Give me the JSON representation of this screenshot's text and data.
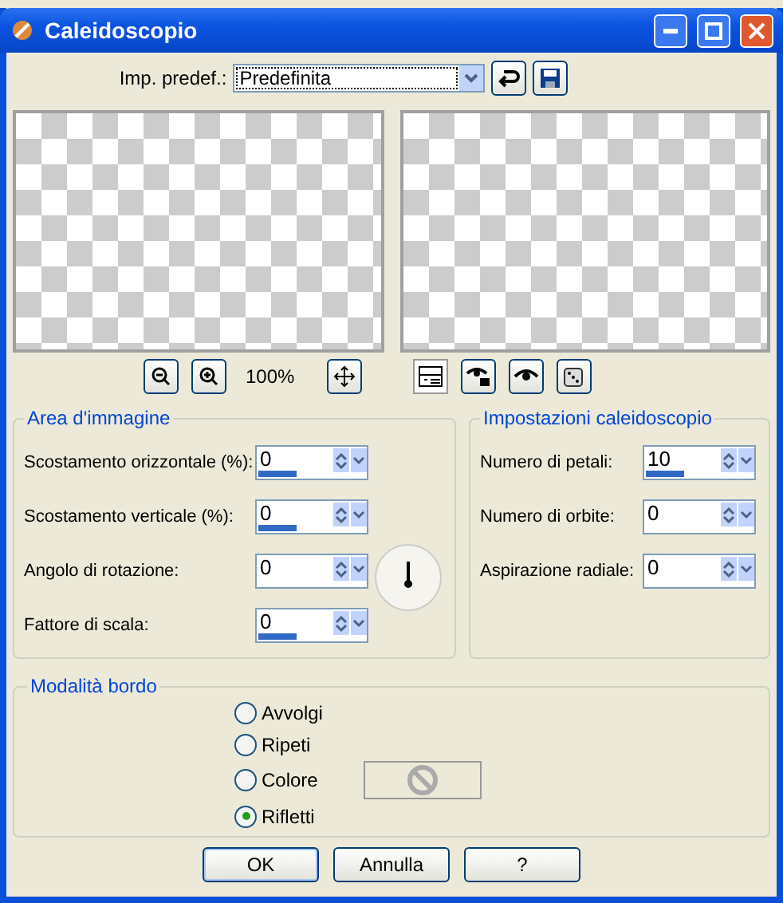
{
  "window": {
    "title": "Caleidoscopio"
  },
  "preset": {
    "label": "Imp. predef.:",
    "value": "Predefinita"
  },
  "preview": {
    "zoom": "100%",
    "layout_toggle_pressed": true
  },
  "image_area": {
    "title": "Area d'immagine",
    "fields": [
      {
        "label": "Scostamento orizzontale (%):",
        "value": "0",
        "level": 0.35
      },
      {
        "label": "Scostamento verticale (%):",
        "value": "0",
        "level": 0.35
      },
      {
        "label": "Angolo di rotazione:",
        "value": "0"
      },
      {
        "label": "Fattore di scala:",
        "value": "0",
        "level": 0.35
      }
    ]
  },
  "kaleidoscope_settings": {
    "title": "Impostazioni caleidoscopio",
    "fields": [
      {
        "label": "Numero di petali:",
        "value": "10",
        "level": 0.35
      },
      {
        "label": "Numero di orbite:",
        "value": "0"
      },
      {
        "label": "Aspirazione radiale:",
        "value": "0"
      }
    ]
  },
  "edge_mode": {
    "title": "Modalità bordo",
    "options": [
      {
        "label": "Avvolgi",
        "selected": false
      },
      {
        "label": "Ripeti",
        "selected": false
      },
      {
        "label": "Colore",
        "selected": false
      },
      {
        "label": "Rifletti",
        "selected": true
      }
    ],
    "color_swatch_disabled": true
  },
  "buttons": [
    "OK",
    "Annulla",
    "?"
  ]
}
